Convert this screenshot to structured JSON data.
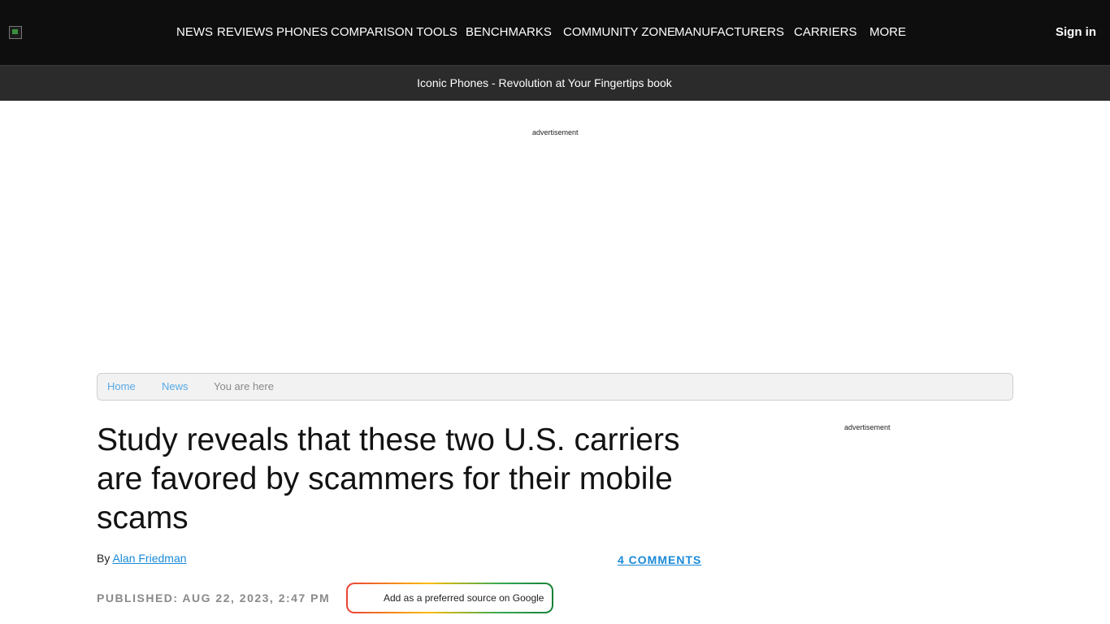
{
  "header": {
    "nav": [
      "NEWS",
      "REVIEWS",
      "PHONES",
      "COMPARISON TOOLS",
      "BENCHMARKS",
      "COMMUNITY ZONE",
      "MANUFACTURERS",
      "CARRIERS",
      "MORE"
    ],
    "sign_in": "Sign in"
  },
  "promo": {
    "text": "Iconic Phones - Revolution at Your Fingertips book"
  },
  "ads": {
    "top_label": "advertisement",
    "side_label": "advertisement"
  },
  "breadcrumb": {
    "items": [
      "Home",
      "News"
    ],
    "current": "You are here"
  },
  "article": {
    "title": "Study reveals that these two U.S. carriers are favored by scammers for their mobile scams",
    "by_prefix": "By",
    "author": "Alan Friedman",
    "comments": "4 COMMENTS",
    "published": "PUBLISHED: AUG 22, 2023, 2:47 PM",
    "preferred_source": "Add as a preferred source on Google"
  },
  "icons": {
    "logo": "site-logo-image",
    "google": "google-g-icon"
  }
}
